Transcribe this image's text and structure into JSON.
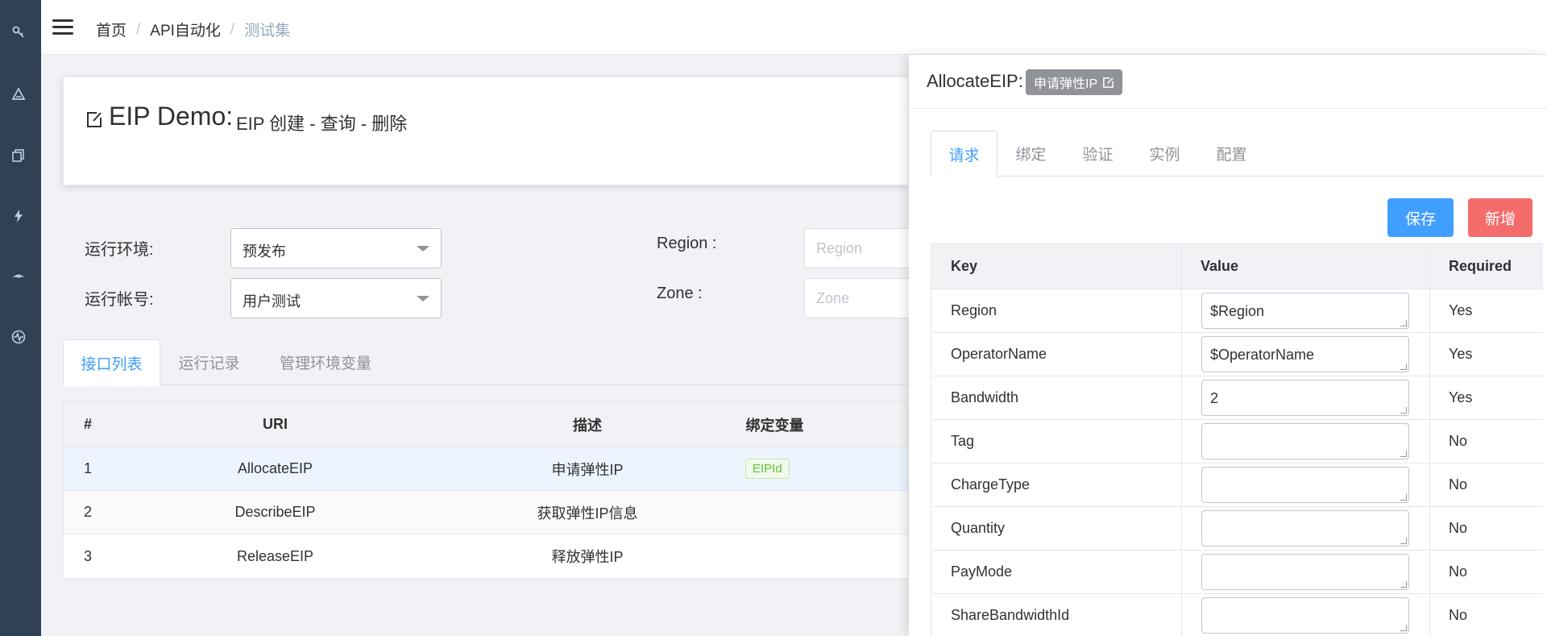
{
  "breadcrumb": {
    "home": "首页",
    "section": "API自动化",
    "current": "测试集"
  },
  "title": {
    "main": "EIP Demo:",
    "subtitle": "EIP 创建 - 查询 - 删除"
  },
  "form": {
    "env_label": "运行环境:",
    "env_value": "预发布",
    "account_label": "运行帐号:",
    "account_value": "用户测试",
    "region_label": "Region :",
    "region_placeholder": "Region",
    "zone_label": "Zone :",
    "zone_placeholder": "Zone"
  },
  "tabs": [
    "接口列表",
    "运行记录",
    "管理环境变量"
  ],
  "api_table": {
    "headers": [
      "#",
      "URI",
      "描述",
      "绑定变量"
    ],
    "rows": [
      {
        "num": "1",
        "uri": "AllocateEIP",
        "desc": "申请弹性IP",
        "var": "EIPId"
      },
      {
        "num": "2",
        "uri": "DescribeEIP",
        "desc": "获取弹性IP信息",
        "var": ""
      },
      {
        "num": "3",
        "uri": "ReleaseEIP",
        "desc": "释放弹性IP",
        "var": ""
      }
    ]
  },
  "panel": {
    "title": "AllocateEIP:",
    "badge": "申请弹性IP",
    "tabs": [
      "请求",
      "绑定",
      "验证",
      "实例",
      "配置"
    ],
    "save_label": "保存",
    "add_label": "新增",
    "headers": [
      "Key",
      "Value",
      "Required"
    ],
    "rows": [
      {
        "key": "Region",
        "value": "$Region",
        "required": "Yes"
      },
      {
        "key": "OperatorName",
        "value": "$OperatorName",
        "required": "Yes"
      },
      {
        "key": "Bandwidth",
        "value": "2",
        "required": "Yes"
      },
      {
        "key": "Tag",
        "value": "",
        "required": "No"
      },
      {
        "key": "ChargeType",
        "value": "",
        "required": "No"
      },
      {
        "key": "Quantity",
        "value": "",
        "required": "No"
      },
      {
        "key": "PayMode",
        "value": "",
        "required": "No"
      },
      {
        "key": "ShareBandwidthId",
        "value": "",
        "required": "No"
      }
    ]
  },
  "colors": {
    "sidebar": "#304156",
    "primary": "#409eff",
    "danger": "#f56c6c",
    "success": "#67c23a"
  }
}
